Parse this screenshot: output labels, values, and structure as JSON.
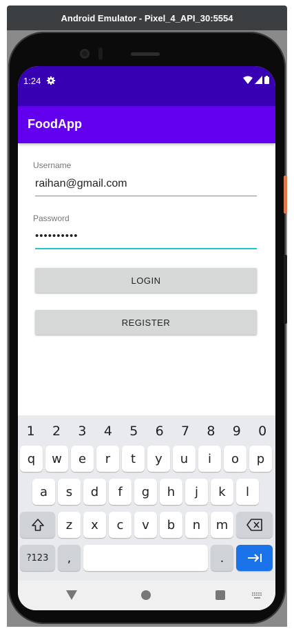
{
  "window": {
    "title": "Android Emulator - Pixel_4_API_30:5554"
  },
  "status_bar": {
    "time": "1:24"
  },
  "app_bar": {
    "title": "FoodApp"
  },
  "login_form": {
    "username_label": "Username",
    "username_value": "raihan@gmail.com",
    "password_label": "Password",
    "password_value": "••••••••••",
    "login_label": "LOGIN",
    "register_label": "REGISTER"
  },
  "keyboard": {
    "numbers": [
      "1",
      "2",
      "3",
      "4",
      "5",
      "6",
      "7",
      "8",
      "9",
      "0"
    ],
    "row1": [
      "q",
      "w",
      "e",
      "r",
      "t",
      "y",
      "u",
      "i",
      "o",
      "p"
    ],
    "row2": [
      "a",
      "s",
      "d",
      "f",
      "g",
      "h",
      "j",
      "k",
      "l"
    ],
    "row3": [
      "z",
      "x",
      "c",
      "v",
      "b",
      "n",
      "m"
    ],
    "symbols_key": "?123",
    "comma_key": ",",
    "period_key": "."
  },
  "colors": {
    "status_bar": "#3700b3",
    "app_bar": "#6200ee",
    "focus_underline": "#1ec8c8",
    "enter_key": "#1a73e8"
  }
}
